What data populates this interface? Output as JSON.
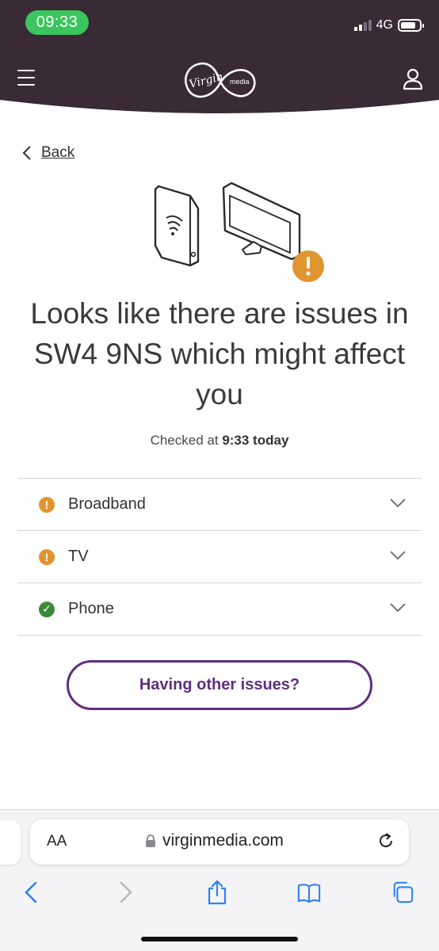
{
  "status_bar": {
    "time": "09:33",
    "network": "4G"
  },
  "header": {
    "menu_icon": "hamburger-menu-icon",
    "logo": {
      "wordmark": "Virgin",
      "sub": "media"
    },
    "account_icon": "person-icon",
    "colors": {
      "header_bg": "#3a2a36",
      "brand_red": "#e10a0a"
    }
  },
  "back": {
    "label": "Back",
    "icon": "chevron-left-icon"
  },
  "illustration": {
    "icon": "router-and-tv-warning-icon"
  },
  "headline": {
    "line1": "Looks like there are issues in",
    "line2": "SW4 9NS which might affect",
    "line3": "you"
  },
  "checked": {
    "prefix": "Checked at",
    "time": "9:33 today"
  },
  "services": [
    {
      "label": "Broadband",
      "status": "warning",
      "icon_glyph": "!"
    },
    {
      "label": "TV",
      "status": "warning",
      "icon_glyph": "!"
    },
    {
      "label": "Phone",
      "status": "ok",
      "icon_glyph": "✓"
    }
  ],
  "colors": {
    "warning": "#e0952f",
    "ok": "#3c8b3a",
    "accent_purple": "#5f2e7e"
  },
  "other_issues_button": {
    "label": "Having other issues?"
  },
  "browser": {
    "text_size_label": "AA",
    "url": "virginmedia.com",
    "toolbar_icons": [
      "back-icon",
      "forward-icon",
      "share-icon",
      "bookmarks-icon",
      "tabs-icon"
    ]
  }
}
